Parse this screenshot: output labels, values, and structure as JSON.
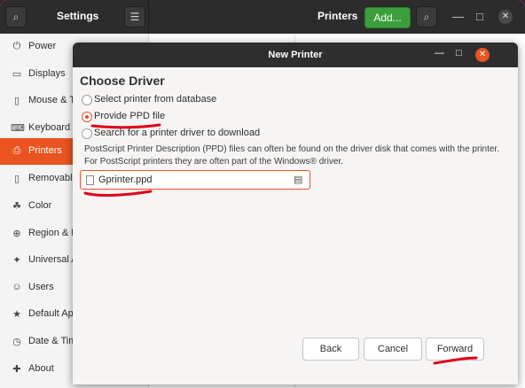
{
  "settings": {
    "title": "Settings",
    "panel_title": "Printers",
    "add_button": "Add...",
    "window_controls": {
      "minimize": "—",
      "maximize": "□",
      "close": "✕"
    }
  },
  "sidebar": {
    "items": [
      {
        "label": "Power",
        "icon": "power-icon",
        "glyph": "⏻"
      },
      {
        "label": "Displays",
        "icon": "display-icon",
        "glyph": "▭"
      },
      {
        "label": "Mouse & To",
        "icon": "mouse-icon",
        "glyph": "▯"
      },
      {
        "label": "Keyboard S",
        "icon": "keyboard-icon",
        "glyph": "⌨"
      },
      {
        "label": "Printers",
        "icon": "printer-icon",
        "glyph": "⎙",
        "active": true
      },
      {
        "label": "Removable",
        "icon": "removable-media-icon",
        "glyph": "▯"
      },
      {
        "label": "Color",
        "icon": "color-icon",
        "glyph": "☘"
      },
      {
        "label": "Region & La",
        "icon": "region-icon",
        "glyph": "⊕"
      },
      {
        "label": "Universal A",
        "icon": "accessibility-icon",
        "glyph": "✦"
      },
      {
        "label": "Users",
        "icon": "users-icon",
        "glyph": "☺"
      },
      {
        "label": "Default Ap",
        "icon": "star-icon",
        "glyph": "★"
      },
      {
        "label": "Date & Tim",
        "icon": "clock-icon",
        "glyph": "◷"
      },
      {
        "label": "About",
        "icon": "about-icon",
        "glyph": "✚"
      }
    ]
  },
  "dialog": {
    "title": "New Printer",
    "heading": "Choose Driver",
    "options": [
      {
        "label": "Select printer from database",
        "selected": false
      },
      {
        "label": "Provide PPD file",
        "selected": true
      },
      {
        "label": "Search for a printer driver to download",
        "selected": false
      }
    ],
    "description": "PostScript Printer Description (PPD) files can often be found on the driver disk that comes with the printer. For PostScript printers they are often part of the Windows® driver.",
    "file_value": "Gprinter.ppd",
    "buttons": {
      "back": "Back",
      "cancel": "Cancel",
      "forward": "Forward"
    },
    "window_controls": {
      "minimize": "—",
      "maximize": "□",
      "close": "✕"
    }
  },
  "colors": {
    "accent": "#e95420",
    "add_button": "#3b9e3b",
    "annotation": "#e0001b"
  }
}
